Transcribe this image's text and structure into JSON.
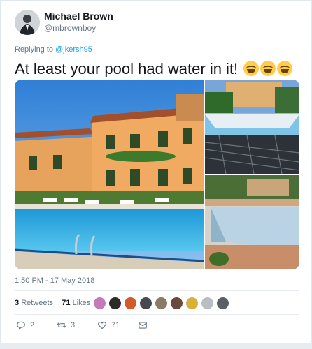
{
  "tweet": {
    "author_name": "Michael Brown",
    "author_handle": "@mbrownboy",
    "replying_prefix": "Replying to ",
    "replying_to": "@jkersh95",
    "text": "At least your pool had water in it!",
    "emoji_count": 3,
    "timestamp": "1:50 PM - 17 May 2018"
  },
  "stats": {
    "retweets_count": "3",
    "retweets_label": "Retweets",
    "likes_count": "71",
    "likes_label": "Likes",
    "liker_avatars": 9
  },
  "actions": {
    "reply_count": "2",
    "retweet_count": "3",
    "like_count": "71"
  },
  "colors": {
    "accent": "#1da1f2",
    "text": "#14171a",
    "secondary": "#657786"
  },
  "icons": [
    "reply-icon",
    "retweet-icon",
    "heart-icon",
    "mail-icon"
  ]
}
